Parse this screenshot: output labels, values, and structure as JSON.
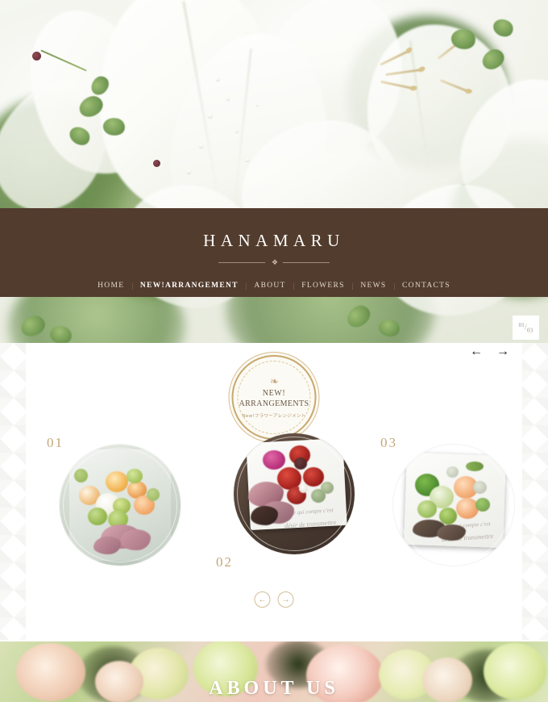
{
  "site": {
    "brand": "HANAMARU",
    "brand_ornament": "❖"
  },
  "nav": {
    "separator": "|",
    "items": [
      {
        "label": "HOME",
        "active": false
      },
      {
        "label": "NEW!ARRANGEMENT",
        "active": true
      },
      {
        "label": "ABOUT",
        "active": false
      },
      {
        "label": "FLOWERS",
        "active": false
      },
      {
        "label": "NEWS",
        "active": false
      },
      {
        "label": "CONTACTS",
        "active": false
      }
    ]
  },
  "hero": {
    "slide_counter": {
      "current": "01",
      "separator": "/",
      "total": "03"
    },
    "prev_icon": "←",
    "next_icon": "→"
  },
  "arrangements": {
    "badge": {
      "ornament": "❧",
      "line1": "NEW!",
      "line2": "ARRANGEMENTS",
      "subtitle": "New!フラワーアレンジメント"
    },
    "cards": [
      {
        "number": "01",
        "caption": ""
      },
      {
        "number": "02",
        "caption": ""
      },
      {
        "number": "03",
        "caption": ""
      }
    ],
    "carousel": {
      "prev_icon": "←",
      "next_icon": "→"
    }
  },
  "about": {
    "title": "ABOUT US"
  },
  "colors": {
    "header_brown": "#523c2e",
    "accent_gold": "#c4a878",
    "badge_border": "#c9a86e",
    "nav_text": "#e3d9cd"
  }
}
